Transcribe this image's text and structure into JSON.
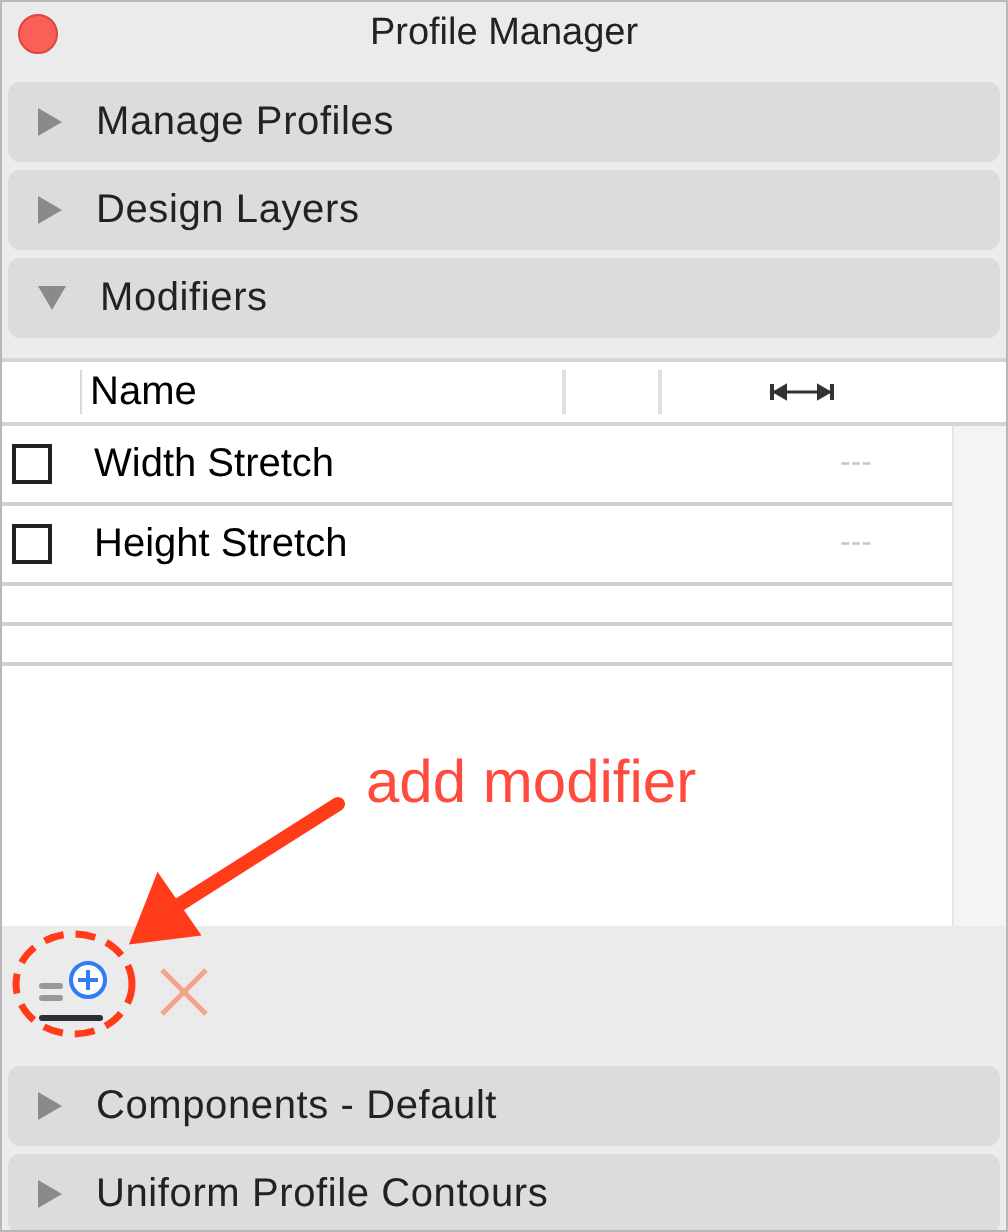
{
  "window": {
    "title": "Profile Manager"
  },
  "sections": [
    {
      "title": "Manage Profiles",
      "expanded": false
    },
    {
      "title": "Design Layers",
      "expanded": false
    },
    {
      "title": "Modifiers",
      "expanded": true,
      "table": {
        "columns": [
          {
            "label": "Name"
          }
        ],
        "rows": [
          {
            "checked": false,
            "name": "Width Stretch",
            "value": "---"
          },
          {
            "checked": false,
            "name": "Height Stretch",
            "value": "---"
          }
        ],
        "toolbar": {
          "delete_disabled": true
        }
      }
    },
    {
      "title": "Components - Default",
      "expanded": false
    },
    {
      "title": "Uniform Profile Contours",
      "expanded": false
    }
  ],
  "annotation": {
    "label": "add modifier"
  }
}
